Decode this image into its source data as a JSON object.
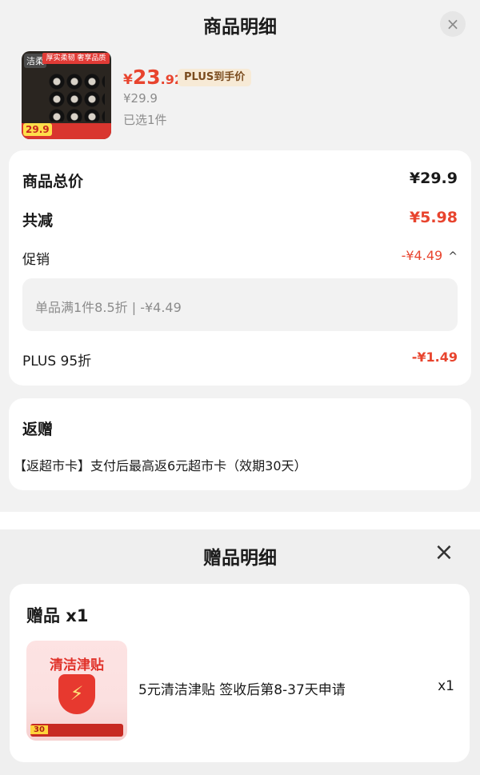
{
  "top_sheet": {
    "title": "商品明细",
    "close_glyph": "×",
    "product": {
      "thumbnail": {
        "brand": "洁柔",
        "banner": "厚实柔韧 奢享品质",
        "price_tag": "29.9"
      },
      "price_yen": "¥",
      "price_int": "23",
      "price_dec": ".92",
      "plus_badge": "PLUS到手价",
      "original_price": "¥29.9",
      "selected": "已选1件"
    },
    "summary": {
      "total_label": "商品总价",
      "total_value": "¥29.9",
      "reduce_label": "共减",
      "reduce_value": "¥5.98",
      "promo_label": "促销",
      "promo_value": "-¥4.49",
      "promo_toggle": "^",
      "promo_detail": "单品满1件8.5折 | -¥4.49",
      "plus_label": "PLUS 95折",
      "plus_value": "-¥1.49"
    },
    "rebate": {
      "title": "返赠",
      "detail": "【返超市卡】支付后最高返6元超市卡（效期30天）"
    }
  },
  "bottom_sheet": {
    "title": "赠品明细",
    "close_glyph": "×",
    "gift": {
      "header": "赠品 x1",
      "image_title": "清洁津贴",
      "image_amount": "30",
      "name": "5元清洁津贴 签收后第8-37天申请",
      "qty": "x1"
    }
  },
  "colors": {
    "accent_red": "#e8442e",
    "plus_gold_bg": "#f7ead6",
    "card_bg": "#ffffff",
    "page_bg": "#f2f2f2"
  },
  "icons": [
    "close-icon",
    "chevron-up-icon",
    "shield-bolt-icon"
  ]
}
